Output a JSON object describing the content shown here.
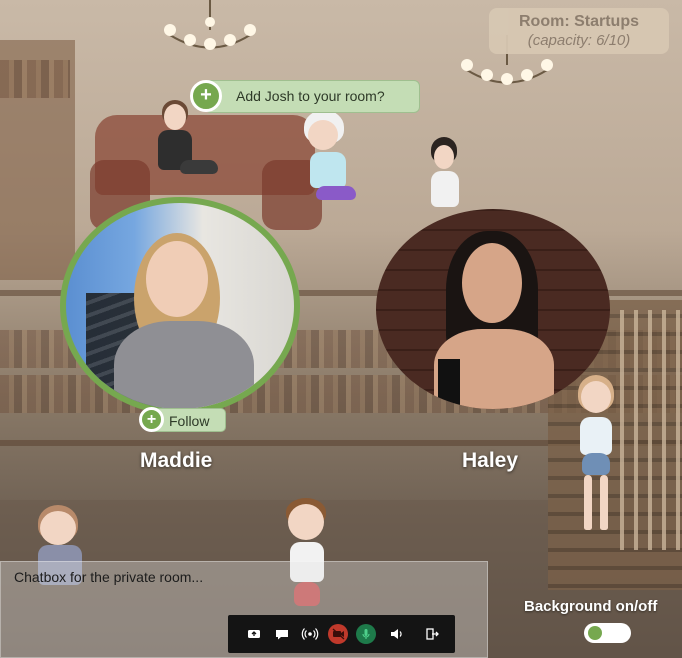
{
  "room": {
    "title": "Room: Startups",
    "capacity": "(capacity: 6/10)"
  },
  "suggestion": {
    "text": "Add Josh to your room?",
    "icon": "plus-icon"
  },
  "participants": [
    {
      "name": "Maddie",
      "follow_label": "Follow",
      "ring_color": "#76a84f"
    },
    {
      "name": "Haley"
    }
  ],
  "chatbox": {
    "placeholder": "Chatbox for the private room..."
  },
  "toolbar": {
    "icons": [
      "share-screen-icon",
      "chat-icon",
      "broadcast-icon",
      "camera-off-icon",
      "microphone-icon",
      "speaker-icon",
      "exit-icon"
    ],
    "camera_off_color": "#c0392b",
    "mic_color": "#1e7a4a"
  },
  "background_toggle": {
    "label": "Background on/off",
    "state": "on"
  },
  "accent": "#76a84f"
}
